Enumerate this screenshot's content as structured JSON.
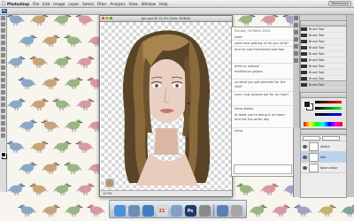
{
  "menubar": {
    "app_name": "Photoshop",
    "items": [
      "File",
      "Edit",
      "Image",
      "Layer",
      "Select",
      "Filter",
      "Analysis",
      "View",
      "Window",
      "Help"
    ],
    "workspace_label": "Workspace"
  },
  "tools_panel": {
    "icon": "ps-logo-icon",
    "ps_label": "Ps"
  },
  "document": {
    "title": "girl.psd @ 12.5% (Hair, RGB/8)",
    "status": "12.5%"
  },
  "chat": {
    "date": "Sunday, 14 March 2010",
    "messages": [
      "yeah",
      "yeee how getting all its you strip?",
      "and he just mentioned saw low",
      "ahhh or wahaa!",
      "mahihihan gaisen",
      "so what you got planned for the rest?",
      "man i just passed out for an hour!",
      "haha awww",
      "at least you're doing it at home and not the other day",
      "haha"
    ]
  },
  "brushes_panel": {
    "title": "Brushes",
    "presets": [
      "Brush Tool",
      "Brush Tool",
      "Brush Tool",
      "Brush Tool",
      "Brush Tool",
      "Brush Tool",
      "Brush Tool",
      "Brush Tool",
      "Brush Tool",
      "Brush Tool"
    ]
  },
  "color_panel": {
    "title": "Color",
    "fg_color": "#1a1a1a",
    "bg_color": "#ffffff"
  },
  "layers_panel": {
    "title": "Layers",
    "layers": [
      {
        "name": "sketch",
        "selected": false
      },
      {
        "name": "hair",
        "selected": true
      },
      {
        "name": "base colour",
        "selected": false
      }
    ]
  },
  "dock": {
    "apps": [
      {
        "name": "finder-icon",
        "color": "#4a90d9"
      },
      {
        "name": "mail-icon",
        "color": "#6b8db8"
      },
      {
        "name": "safari-icon",
        "color": "#3f7fc0"
      },
      {
        "name": "calendar-icon",
        "color": "#d9d9d9",
        "label": "21"
      },
      {
        "name": "itunes-icon",
        "color": "#7fa0c8"
      },
      {
        "name": "photoshop-icon",
        "color": "#1d3a66",
        "label": "Ps"
      },
      {
        "name": "settings-icon",
        "color": "#8a8a8a"
      },
      {
        "name": "folder-icon",
        "color": "#5a7fb0"
      },
      {
        "name": "trash-icon",
        "color": "#a6a6a6"
      }
    ]
  }
}
